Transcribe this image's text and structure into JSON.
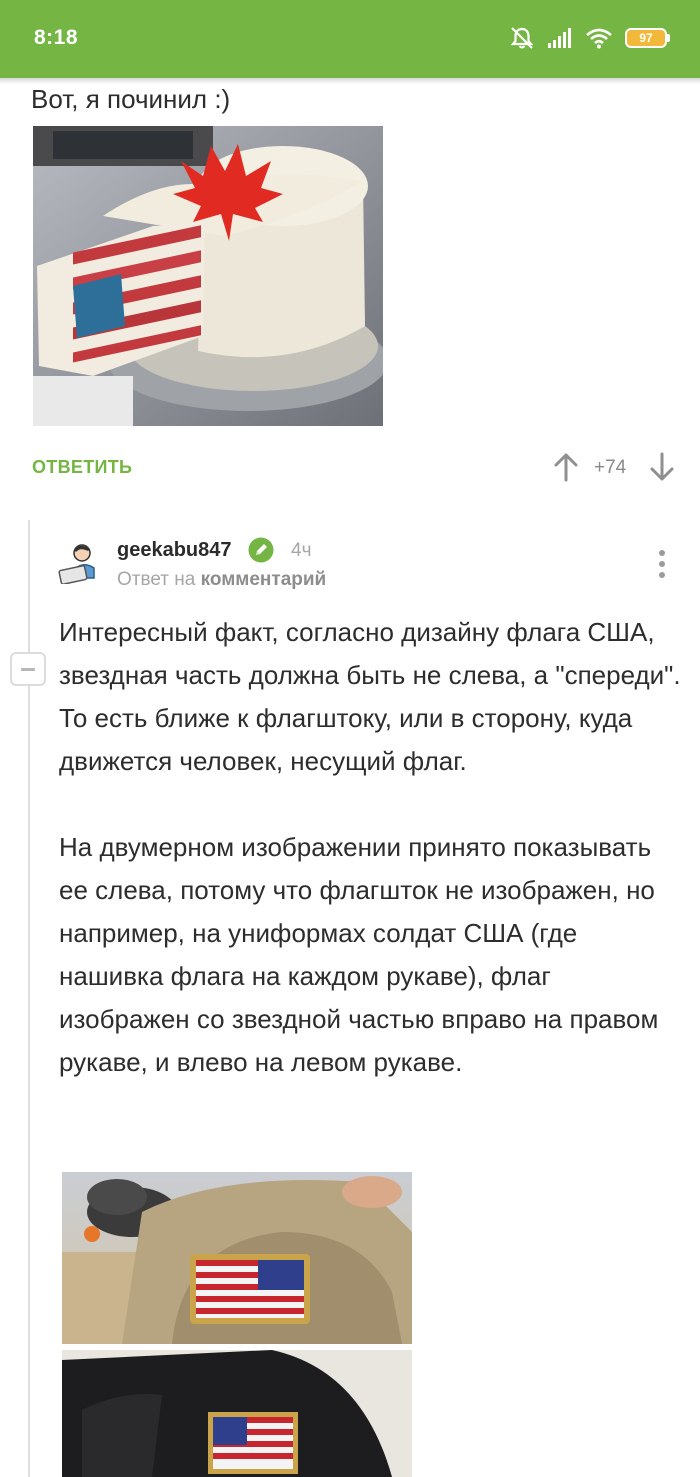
{
  "status_bar": {
    "time": "8:18",
    "battery": "97",
    "icons": [
      "mute-icon",
      "signal-icon",
      "wifi-icon",
      "battery-icon"
    ]
  },
  "parent_comment": {
    "text": "Вот, я починил :)",
    "image": "cake-photo",
    "reply_label": "ОТВЕТИТЬ",
    "rating": "+74"
  },
  "reply": {
    "username": "geekabu847",
    "age": "4ч",
    "reply_to_prefix": "Ответ на",
    "reply_to_target": "комментарий",
    "text": "Интересный факт, согласно дизайну флага США, звездная часть должна быть не слева, а \"спереди\". То есть ближе к флагштоку, или в сторону, куда движется человек, несущий флаг.\n\nНа двумерном изображении принято показывать ее слева, потому что флагшток не изображен, но например, на униформах солдат США (где нашивка флага на каждом рукаве), флаг изображен со звездной частью вправо на правом рукаве, и влево на левом рукаве.",
    "images": [
      "soldier-sleeve-photo",
      "black-uniform-sleeve-photo"
    ]
  },
  "colors": {
    "accent": "#75b544",
    "muted_text": "#a6a6a6",
    "thread_line": "#dedede"
  }
}
